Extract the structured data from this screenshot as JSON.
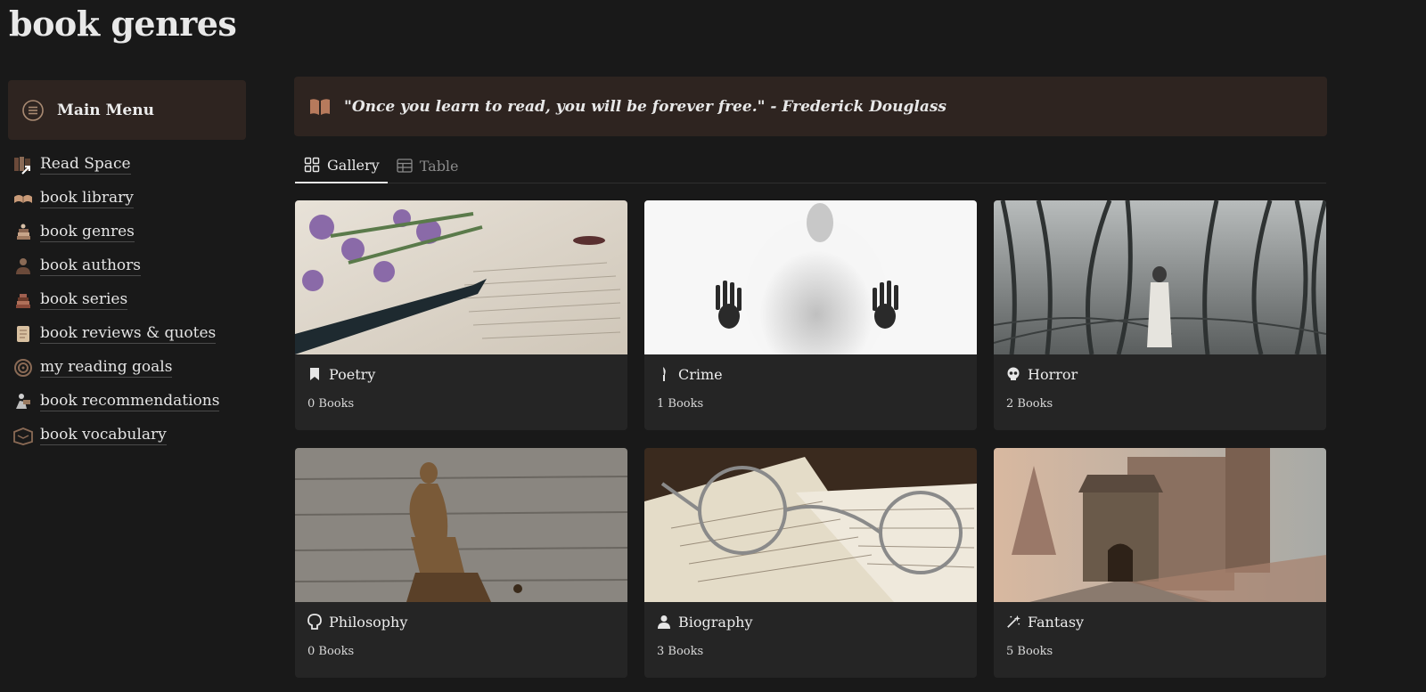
{
  "page": {
    "title": "book genres"
  },
  "sidebar": {
    "menu_label": "Main Menu",
    "items": [
      {
        "label": "Read Space",
        "icon": "books-link-icon"
      },
      {
        "label": "book library",
        "icon": "open-book-icon"
      },
      {
        "label": "book genres",
        "icon": "book-stack-icon"
      },
      {
        "label": "book authors",
        "icon": "author-icon"
      },
      {
        "label": "book series",
        "icon": "book-series-icon"
      },
      {
        "label": "book reviews & quotes",
        "icon": "scroll-icon"
      },
      {
        "label": "my reading goals",
        "icon": "target-icon"
      },
      {
        "label": "book recommendations",
        "icon": "reader-icon"
      },
      {
        "label": "book vocabulary",
        "icon": "dictionary-icon"
      }
    ]
  },
  "callout": {
    "text": "\"Once you learn to read, you will be forever free.\" - Frederick Douglass",
    "icon": "open-book-icon"
  },
  "tabs": [
    {
      "label": "Gallery",
      "active": true,
      "icon": "gallery-icon"
    },
    {
      "label": "Table",
      "active": false,
      "icon": "table-icon"
    }
  ],
  "cards": [
    {
      "title": "Poetry",
      "count": "0 Books",
      "icon": "bookmark-icon"
    },
    {
      "title": "Crime",
      "count": "1 Books",
      "icon": "knife-icon"
    },
    {
      "title": "Horror",
      "count": "2 Books",
      "icon": "skull-icon"
    },
    {
      "title": "Philosophy",
      "count": "0 Books",
      "icon": "head-icon"
    },
    {
      "title": "Biography",
      "count": "3 Books",
      "icon": "person-icon"
    },
    {
      "title": "Fantasy",
      "count": "5 Books",
      "icon": "magic-wand-icon"
    }
  ],
  "colors": {
    "background": "#191919",
    "callout_bg": "#2e2420",
    "card_bg": "#252525",
    "accent_brown": "#b77a5c"
  }
}
